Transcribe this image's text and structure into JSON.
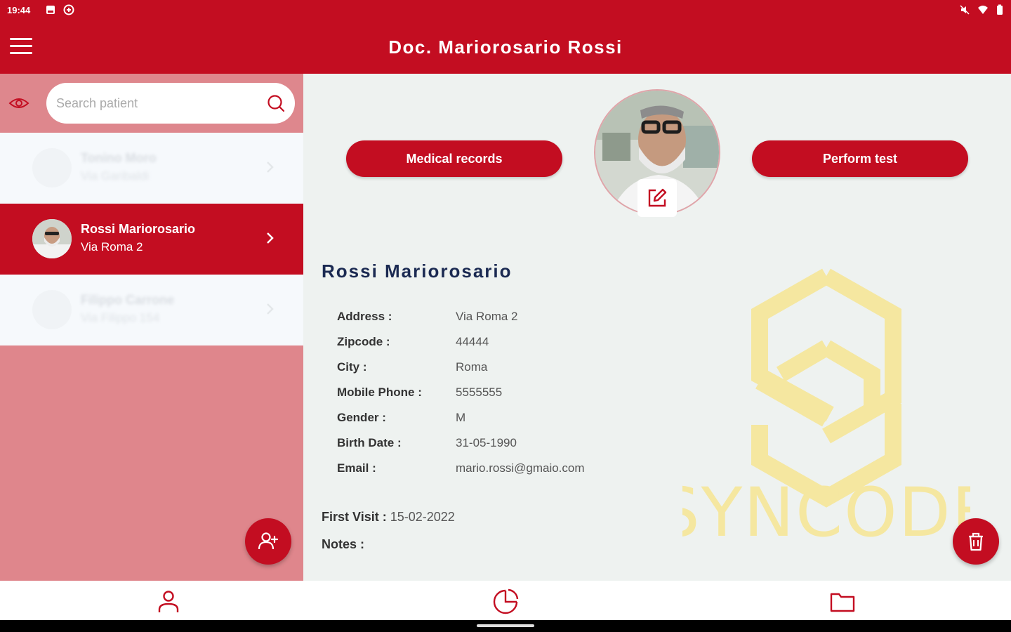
{
  "status": {
    "time": "19:44"
  },
  "appbar": {
    "title": "Doc. Mariorosario Rossi"
  },
  "search": {
    "placeholder": "Search patient"
  },
  "patients": [
    {
      "name": "Tonino Moro",
      "address": "Via Garibaldi"
    },
    {
      "name": "Rossi Mariorosario",
      "address": "Via Roma 2"
    },
    {
      "name": "Filippo Carrone",
      "address": "Via Filippo 154"
    }
  ],
  "actions": {
    "medical_records": "Medical records",
    "perform_test": "Perform test"
  },
  "patient": {
    "full_name": "Rossi Mariorosario",
    "details": [
      {
        "label": "Address :",
        "value": "Via Roma 2"
      },
      {
        "label": "Zipcode :",
        "value": "44444"
      },
      {
        "label": "City :",
        "value": "Roma"
      },
      {
        "label": "Mobile Phone :",
        "value": "5555555"
      },
      {
        "label": "Gender :",
        "value": "M"
      },
      {
        "label": "Birth Date :",
        "value": "31-05-1990"
      },
      {
        "label": "Email :",
        "value": "mario.rossi@gmaio.com"
      }
    ],
    "first_visit_label": "First Visit :",
    "first_visit": "15-02-2022",
    "notes_label": "Notes :"
  },
  "watermark": "SYNCODE",
  "colors": {
    "primary": "#c30d21",
    "sidebar": "#df868c",
    "main_bg": "#eef2f0",
    "title": "#1b2a52",
    "watermark": "#f5e7a0"
  },
  "icons": {
    "menu": "menu-icon",
    "eye": "eye-icon",
    "search": "search-icon",
    "chevron": "chevron-right-icon",
    "add_user": "add-user-icon",
    "edit": "edit-icon",
    "delete": "trash-icon",
    "nav_patients": "person-icon",
    "nav_stats": "pie-chart-icon",
    "nav_files": "folder-icon"
  }
}
